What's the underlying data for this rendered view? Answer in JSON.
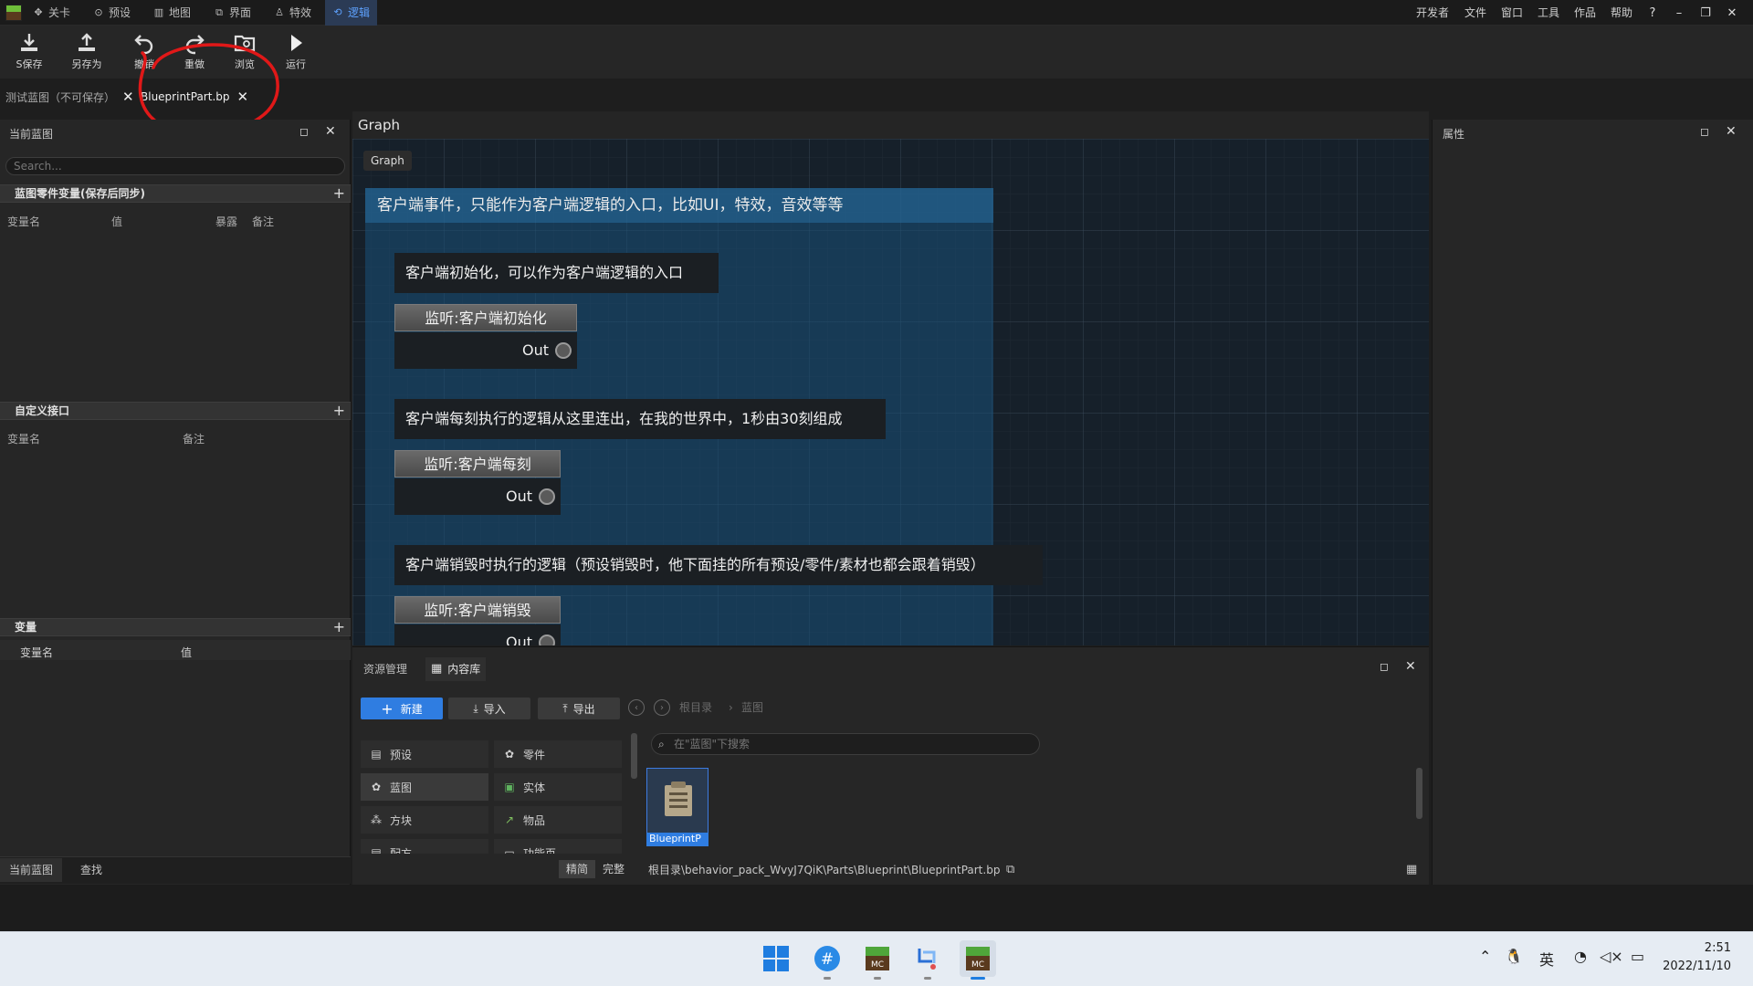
{
  "menubar": {
    "tabs": [
      {
        "label": "关卡",
        "icon": "compass-icon"
      },
      {
        "label": "预设",
        "icon": "gear-icon"
      },
      {
        "label": "地图",
        "icon": "map-icon"
      },
      {
        "label": "界面",
        "icon": "window-icon"
      },
      {
        "label": "特效",
        "icon": "person-icon"
      },
      {
        "label": "逻辑",
        "icon": "logic-icon",
        "active": true
      }
    ],
    "right_items": [
      "开发者",
      "文件",
      "窗口",
      "工具",
      "作品",
      "帮助"
    ],
    "help_icon": "?"
  },
  "toolbar": {
    "save_label": "保存",
    "save_prefix": "S",
    "save_as_label": "另存为",
    "undo_label": "撤销",
    "redo_label": "重做",
    "browse_label": "浏览",
    "run_label": "运行"
  },
  "doc_tabs": [
    {
      "label": "测试蓝图（不可保存）"
    },
    {
      "label": "BlueprintPart.bp",
      "active": true
    }
  ],
  "left_panel": {
    "title": "当前蓝图",
    "search_placeholder": "Search...",
    "sections": {
      "part_vars": {
        "title": "蓝图零件变量(保存后同步)",
        "cols": [
          "变量名",
          "值",
          "暴露",
          "备注"
        ]
      },
      "custom_iface": {
        "title": "自定义接口",
        "cols": [
          "变量名",
          "备注"
        ]
      },
      "vars": {
        "title": "变量",
        "cols": [
          "变量名",
          "值"
        ]
      }
    },
    "bottom_tabs": [
      "当前蓝图",
      "查找"
    ]
  },
  "graph": {
    "header": "Graph",
    "chip": "Graph",
    "group_title": "客户端事件，只能作为客户端逻辑的入口，比如UI，特效，音效等等",
    "comments": [
      "客户端初始化，可以作为客户端逻辑的入口",
      "客户端每刻执行的逻辑从这里连出，在我的世界中，1秒由30刻组成",
      "客户端销毁时执行的逻辑（预设销毁时，他下面挂的所有预设/零件/素材也都会跟着销毁）"
    ],
    "nodes": [
      {
        "title": "监听:客户端初始化",
        "out": "Out"
      },
      {
        "title": "监听:客户端每刻",
        "out": "Out"
      },
      {
        "title": "监听:客户端销毁",
        "out": "Out"
      }
    ]
  },
  "right_panel": {
    "title": "属性"
  },
  "content_lib": {
    "tabs": [
      "资源管理",
      "内容库"
    ],
    "new_label": "新建",
    "import_label": "导入",
    "export_label": "导出",
    "breadcrumb": [
      "根目录",
      "蓝图"
    ],
    "search_placeholder": "在\"蓝图\"下搜索",
    "categories": [
      "预设",
      "零件",
      "蓝图",
      "实体",
      "方块",
      "物品",
      "配方",
      "功能页"
    ],
    "asset_label": "BlueprintP",
    "path": "根目录\\behavior_pack_WvyJ7QiK\\Parts\\Blueprint\\BlueprintPart.bp",
    "view_toggle": [
      "精简",
      "完整"
    ]
  },
  "taskbar": {
    "tray_lang": "英",
    "time": "2:51",
    "date": "2022/11/10"
  },
  "colors": {
    "accent": "#2f7de1",
    "active_tab_text": "#5ea2ff",
    "annotation_red": "#e01818"
  }
}
